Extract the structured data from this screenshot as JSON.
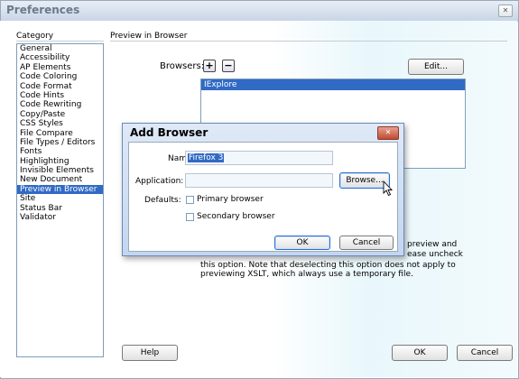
{
  "window": {
    "title": "Preferences",
    "close_glyph": "✕"
  },
  "category": {
    "heading": "Category",
    "items": [
      "General",
      "Accessibility",
      "AP Elements",
      "Code Coloring",
      "Code Format",
      "Code Hints",
      "Code Rewriting",
      "Copy/Paste",
      "CSS Styles",
      "File Compare",
      "File Types / Editors",
      "Fonts",
      "Highlighting",
      "Invisible Elements",
      "New Document",
      "Preview in Browser",
      "Site",
      "Status Bar",
      "Validator"
    ],
    "selected_index": 15
  },
  "panel": {
    "heading": "Preview in Browser",
    "browsers_label": "Browsers:",
    "add_glyph": "+",
    "remove_glyph": "−",
    "edit_label": "Edit...",
    "browser_list": [
      "IExplore"
    ],
    "description_fragments": [
      "preview and",
      "ease uncheck",
      "this option. Note that deselecting this option does not apply to",
      "previewing XSLT, which always use a temporary file."
    ]
  },
  "footer": {
    "help_label": "Help",
    "ok_label": "OK",
    "cancel_label": "Cancel"
  },
  "dialog": {
    "title": "Add Browser",
    "close_glyph": "✕",
    "name_label": "Name:",
    "name_value": "Firefox 3",
    "application_label": "Application:",
    "application_value": "",
    "browse_label": "Browse...",
    "defaults_label": "Defaults:",
    "primary_label": "Primary browser",
    "primary_checked": false,
    "secondary_label": "Secondary browser",
    "secondary_checked": false,
    "ok_label": "OK",
    "cancel_label": "Cancel"
  },
  "colors": {
    "selection": "#316ac5",
    "dialog_bg": "#c4d6ef",
    "accent_border": "#2a6dcc"
  },
  "icons": {
    "cursor": "arrow-cursor-icon"
  }
}
